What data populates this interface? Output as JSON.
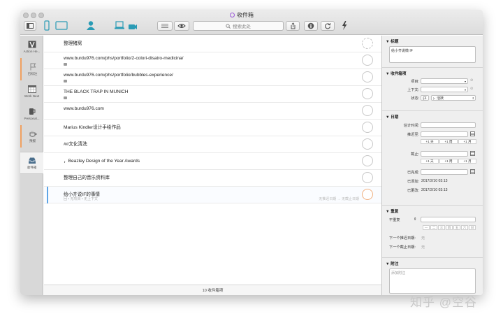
{
  "window": {
    "title": "收件箱",
    "title_icon": "inbox-circle-icon",
    "toolbar": {
      "search_placeholder": "搜索此处",
      "icons": [
        "sidebar-toggle-icon",
        "phone-icon",
        "tablet-icon",
        "person-icon",
        "laptop-icon",
        "camera-icon",
        "list-icon",
        "eye-icon",
        "share-icon",
        "info-icon",
        "sync-icon",
        "quick-entry-icon"
      ]
    }
  },
  "sidebar": {
    "items": [
      {
        "label": "Action He...",
        "icon": "v-badge-icon"
      },
      {
        "label": "已标注",
        "icon": "flag-icon"
      },
      {
        "label": "Work Next",
        "icon": "calendar-grid-icon"
      },
      {
        "label": "Personal...",
        "icon": "mug-icon"
      },
      {
        "label": "预报",
        "icon": "coffee-cup-icon"
      },
      {
        "label": "收件箱",
        "icon": "inbox-tray-icon"
      }
    ]
  },
  "tasks": [
    {
      "title": "整理猪窝",
      "note": false
    },
    {
      "title": "www.burdu976.com/phs/portfolio/2-colori-disatro-medicina/",
      "note": true
    },
    {
      "title": "www.burdu976.com/phs/portfolio/bubbles-experience/",
      "note": true
    },
    {
      "title": "THE BLACK TRAP IN MUNICH",
      "note": true
    },
    {
      "title": "www.burdu976.com",
      "note": false
    },
    {
      "title": "Marius Kindler设计手绘作品",
      "note": false
    },
    {
      "title": "##文化清洗",
      "note": false
    },
    {
      "title": "，Beazley Design of the Year Awards",
      "note": false
    },
    {
      "title": "整理自己的音乐资料库",
      "note": false
    },
    {
      "title": "给小齐说IF的事情",
      "note": false,
      "selected": true,
      "sub_left": "回 • 无项目 • 无上下文",
      "sub_right": "无推迟日期 → 无截止日期"
    }
  ],
  "footer": {
    "count_label": "10 收件箱项"
  },
  "inspector": {
    "title_section": {
      "header": "标题",
      "value": "给小齐说微 IF"
    },
    "inbox_section": {
      "header": "收件箱项",
      "project_label": "项目:",
      "context_label": "上下文:",
      "status_label": "状态:",
      "status_value": "活跃"
    },
    "date_section": {
      "header": "日期",
      "estimate_label": "估计时间:",
      "defer_label": "推迟至:",
      "due_label": "截止:",
      "completed_label": "已完成:",
      "added_label": "已添加:",
      "added_value": "2017/2/10 03:13",
      "modified_label": "已更改:",
      "modified_value": "2017/2/10 03:13",
      "defer_buttons": [
        "+1 天",
        "+1 周",
        "+1 月"
      ],
      "due_buttons": [
        "+1 天",
        "+1 周",
        "+1 月"
      ]
    },
    "repeat_section": {
      "header": "重复",
      "mode_value": "不重复",
      "weekdays": [
        "一",
        "二",
        "三",
        "四",
        "五",
        "六",
        "日"
      ],
      "next_defer_label": "下一个推迟日期:",
      "next_defer_value": "无",
      "next_due_label": "下一个截止日期:",
      "next_due_value": "无"
    },
    "note_section": {
      "header": "附注",
      "placeholder": "添加附注"
    }
  },
  "watermark": "知乎 @空谷",
  "colors": {
    "selection": "#5ea5e6",
    "accent_purple": "#9b59d8",
    "sidebar_active": "#f2f2f2",
    "flag_orange": "#f0a060"
  }
}
